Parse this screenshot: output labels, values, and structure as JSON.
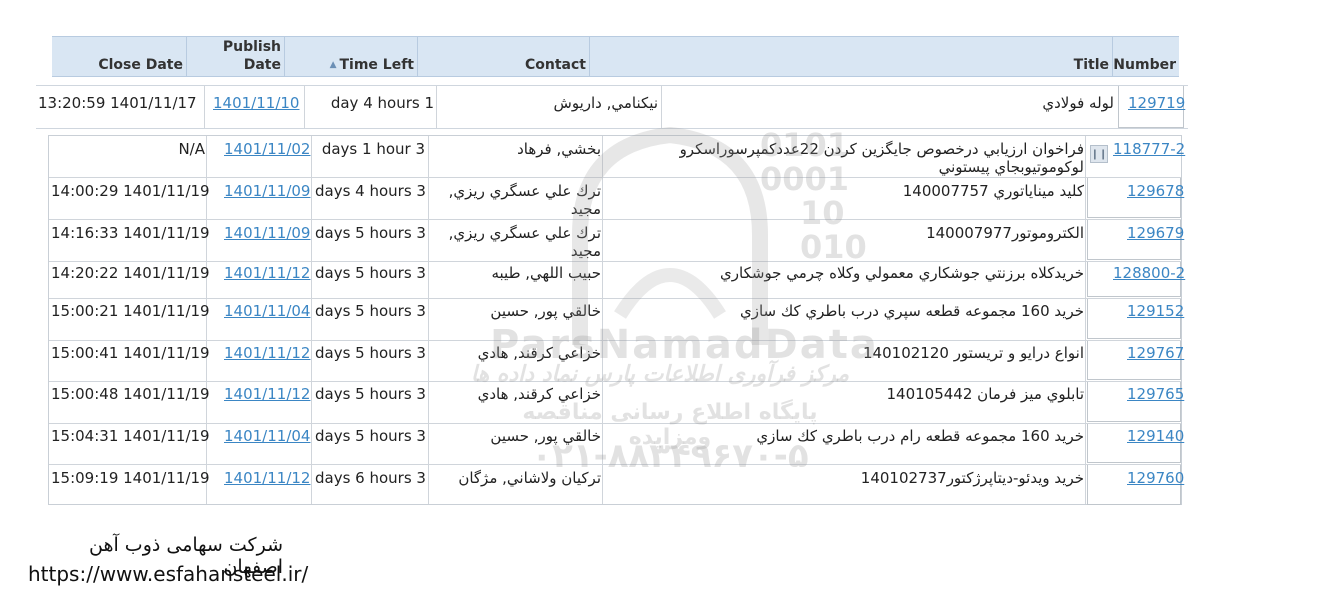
{
  "columns": {
    "close_date": "Close Date",
    "publish_date_line1": "Publish",
    "publish_date_line2": "Date",
    "time_left": "Time Left",
    "contact": "Contact",
    "title": "Title",
    "number": "Number"
  },
  "rows": [
    {
      "number": "129719",
      "title": "لوله فولادي",
      "contact": "نيكنامي, داريوش",
      "time_left": "day 4 hours 1",
      "publish_date": "1401/11/10",
      "close_date": "13:20:59 1401/11/17"
    },
    {
      "number": "118777-2",
      "title": "فراخوان ارزيابي درخصوص جايگزين كردن 22عددكمپرسوراسكرو",
      "title_line2": "لوكوموتيوبجاي پيستوني",
      "contact": "بخشي, فرهاد",
      "time_left": "days 1 hour 3",
      "publish_date": "1401/11/02",
      "close_date": "N/A"
    },
    {
      "number": "129678",
      "title": "كليد ميناياتوري 140007757",
      "contact": "ترك علي عسگري ريزي,",
      "contact_line2": "مجيد",
      "time_left": "days 4 hours 3",
      "publish_date": "1401/11/09",
      "close_date": "14:00:29 1401/11/19"
    },
    {
      "number": "129679",
      "title": "الكتروموتور140007977",
      "contact": "ترك علي عسگري ريزي,",
      "contact_line2": "مجيد",
      "time_left": "days 5 hours 3",
      "publish_date": "1401/11/09",
      "close_date": "14:16:33 1401/11/19"
    },
    {
      "number": "128800-2",
      "title": "خريدكلاه برزنتي جوشكاري معمولي وكلاه چرمي جوشكاري",
      "contact": "حبيب اللهي, طيبه",
      "time_left": "days 5 hours 3",
      "publish_date": "1401/11/12",
      "close_date": "14:20:22 1401/11/19"
    },
    {
      "number": "129152",
      "title": "خريد 160 مجموعه قطعه سپري درب باطري كك سازي",
      "contact": "خالقي پور, حسين",
      "time_left": "days 5 hours 3",
      "publish_date": "1401/11/04",
      "close_date": "15:00:21 1401/11/19"
    },
    {
      "number": "129767",
      "title": "انواع درايو و تريستور 140102120",
      "contact": "خزاعي كرقند, هادي",
      "time_left": "days 5 hours 3",
      "publish_date": "1401/11/12",
      "close_date": "15:00:41 1401/11/19"
    },
    {
      "number": "129765",
      "title": "تابلوي ميز فرمان 140105442",
      "contact": "خزاعي كرقند, هادي",
      "time_left": "days 5 hours 3",
      "publish_date": "1401/11/12",
      "close_date": "15:00:48 1401/11/19"
    },
    {
      "number": "129140",
      "title": "خريد 160 مجموعه قطعه رام درب باطري كك سازي",
      "contact": "خالقي پور, حسين",
      "time_left": "days 5 hours 3",
      "publish_date": "1401/11/04",
      "close_date": "15:04:31 1401/11/19"
    },
    {
      "number": "129760",
      "title": "خريد ويدئو-ديتاپرژكتور140102737",
      "contact": "تركيان ولاشاني, مژگان",
      "time_left": "days 6 hours 3",
      "publish_date": "1401/11/12",
      "close_date": "15:09:19 1401/11/19"
    }
  ],
  "watermark": {
    "brand": "ParsNamadData",
    "line1": "مرکز فرآوری اطلاعات پارس نماد داده ها",
    "line2": "پایگاه اطلاع رسانی مناقصه ومزایده",
    "phone": "۰۲۱-۸۸۳۴۹۶۷۰-۵",
    "digits": [
      "0101",
      "0001",
      "10",
      "010"
    ]
  },
  "footer": {
    "company": "شرکت سهامی ذوب آهن اصفهان",
    "url": "https://www.esfahansteel.ir/"
  },
  "colors": {
    "header_bg": "#d9e6f3",
    "link": "#3b86c4"
  },
  "icons": [
    "sort-up-icon",
    "pause-icon"
  ]
}
